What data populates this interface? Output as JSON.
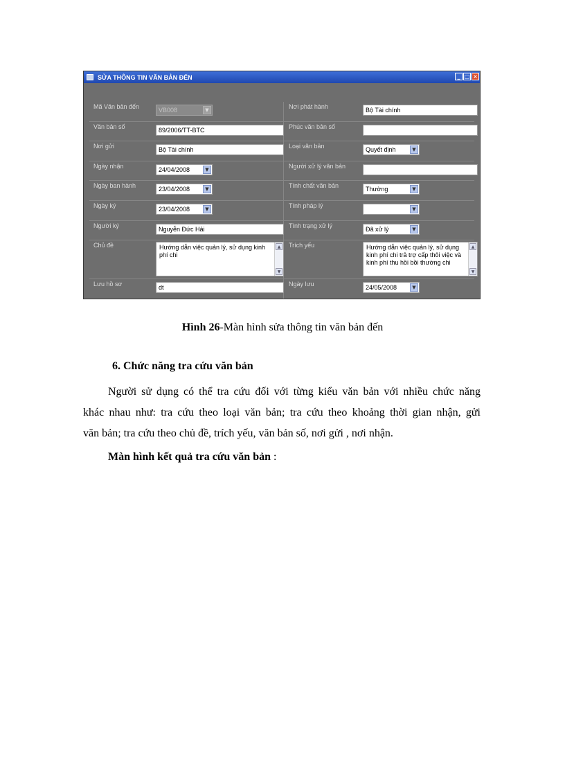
{
  "window": {
    "title": "SỬA THÔNG TIN VĂN BẢN ĐẾN",
    "minimize": "_",
    "maximize": "□",
    "close": "×"
  },
  "form": {
    "ma_van_ban_den": {
      "label": "Mã Văn bản đến",
      "value": "VB008"
    },
    "noi_phat_hanh": {
      "label": "Nơi phát hành",
      "value": "Bộ Tài chính"
    },
    "van_ban_so": {
      "label": "Văn bản số",
      "value": "89/2006/TT-BTC"
    },
    "phuc_van_ban_so": {
      "label": "Phúc văn bản số",
      "value": ""
    },
    "noi_gui": {
      "label": "Nơi gửi",
      "value": "Bộ Tài chính"
    },
    "loai_van_ban": {
      "label": "Loại văn bản",
      "value": "Quyết định"
    },
    "ngay_nhan": {
      "label": "Ngày nhận",
      "value": "24/04/2008"
    },
    "nguoi_xu_ly": {
      "label": "Người xử lý văn bản",
      "value": ""
    },
    "ngay_ban_hanh": {
      "label": "Ngày ban hành",
      "value": "23/04/2008"
    },
    "tinh_chat": {
      "label": "Tính chất văn bản",
      "value": "Thường"
    },
    "ngay_ky": {
      "label": "Ngày ký",
      "value": "23/04/2008"
    },
    "tinh_phap_ly": {
      "label": "Tính pháp lý",
      "value": ""
    },
    "nguoi_ky": {
      "label": "Người  ký",
      "value": "Nguyễn Đức Hải"
    },
    "tinh_trang_xu_ly": {
      "label": "Tình trạng xử lý",
      "value": "Đã xử lý"
    },
    "chu_de": {
      "label": "Chủ đề",
      "value": "Hướng dẫn việc quản lý, sử dụng kinh phí chi"
    },
    "trich_yeu": {
      "label": "Trích yếu",
      "value": "Hướng dẫn việc quản lý, sử dụng kinh phí chi trả trợ cấp thôi việc và kinh phí thu hồi bồi thường chi"
    },
    "luu_ho_so": {
      "label": "Lưu hồ sơ",
      "value": "dt"
    },
    "ngay_luu": {
      "label": "Ngày lưu",
      "value": "24/05/2008"
    }
  },
  "document": {
    "caption_bold": "Hình 26",
    "caption_rest": "-Màn hình sửa thông tin văn bản đến",
    "heading": "6.  Chức năng tra cứu văn bản",
    "para_line1": "Người sử dụng có thể tra cứu đối với từng kiểu văn bản với nhiều chức năng",
    "para_line2": "khác nhau như: tra cứu theo loại văn bản; tra cứu theo khoảng thời gian nhận, gửi",
    "para_line3": "văn bản; tra cứu theo chủ đề, trích yếu, văn bản số, nơi gửi , nơi nhận.",
    "result_bold": "Màn hình kết quả tra cứu văn bản",
    "result_rest": " :"
  },
  "icons": {
    "dropdown": "chevron-down-icon",
    "scroll_up": "▲",
    "scroll_down": "▼"
  }
}
